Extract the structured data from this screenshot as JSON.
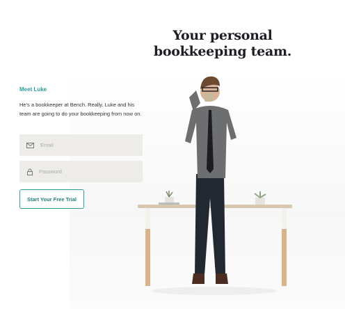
{
  "hero": {
    "title_line1": "Your personal",
    "title_line2": "bookkeeping team."
  },
  "intro": {
    "eyebrow": "Meet Luke",
    "description": "He's a bookkeeper at Bench. Really. Luke and his team are going to do your bookkeeping from now on."
  },
  "form": {
    "email": {
      "placeholder": "Email",
      "value": "",
      "icon": "envelope-icon"
    },
    "password": {
      "placeholder": "Password",
      "value": "",
      "icon": "lock-icon"
    },
    "submit_label": "Start Your Free Trial"
  },
  "colors": {
    "accent": "#2a9d9a",
    "field_bg": "#eeece8",
    "title": "#1e1e24"
  }
}
